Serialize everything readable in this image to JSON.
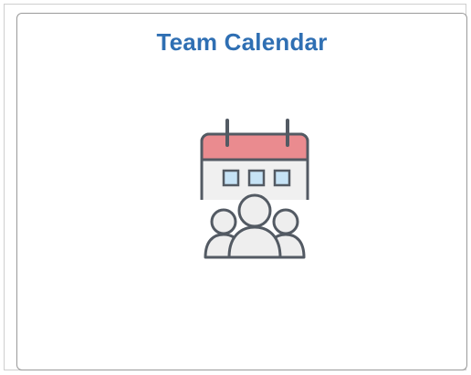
{
  "tile": {
    "title": "Team Calendar",
    "icon": "team-calendar-icon"
  },
  "colors": {
    "title": "#2f6fb3",
    "calendar_header": "#ea8b8f",
    "calendar_body": "#f0f0f0",
    "calendar_cells": "#c6e3f6",
    "outline": "#535a63",
    "people_fill": "#eeeeee"
  }
}
